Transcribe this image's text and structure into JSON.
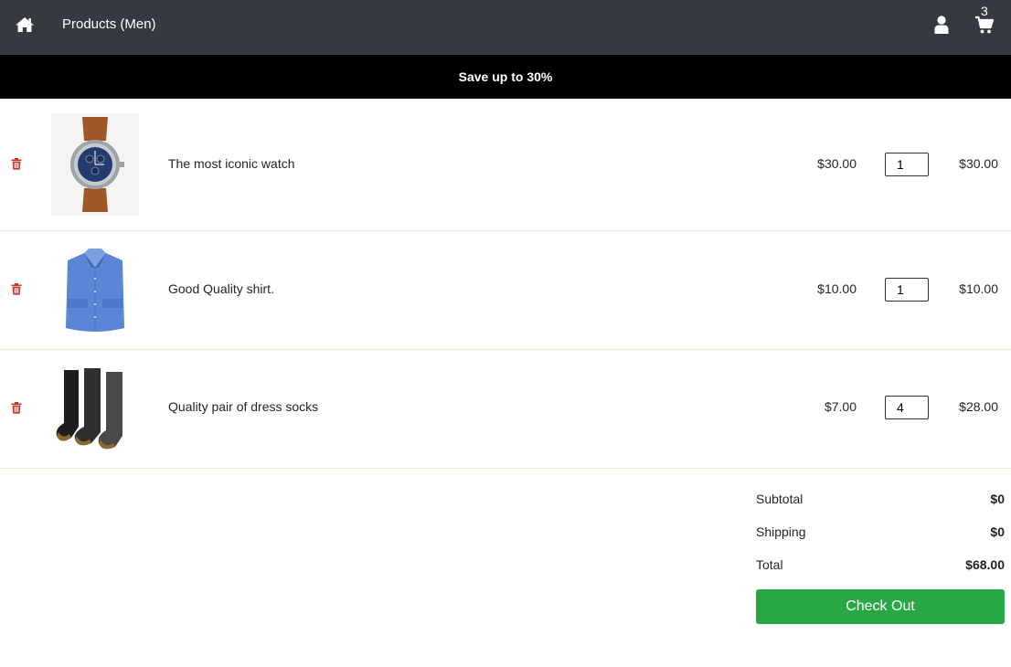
{
  "nav": {
    "title": "Products (Men)",
    "cart_count": "3"
  },
  "promo": {
    "text": "Save up to 30%"
  },
  "cart": {
    "items": [
      {
        "name": "The most iconic watch",
        "price": "$30.00",
        "quantity": "1",
        "total": "$30.00",
        "image": "wristwatch"
      },
      {
        "name": "Good Quality shirt.",
        "price": "$10.00",
        "quantity": "1",
        "total": "$10.00",
        "image": "blue-dress-shirt"
      },
      {
        "name": "Quality pair of dress socks",
        "price": "$7.00",
        "quantity": "4",
        "total": "$28.00",
        "image": "dress-socks"
      }
    ]
  },
  "summary": {
    "subtotal_label": "Subtotal",
    "subtotal_value": "$0",
    "shipping_label": "Shipping",
    "shipping_value": "$0",
    "total_label": "Total",
    "total_value": "$68.00",
    "checkout_label": "Check Out"
  },
  "colors": {
    "navbar": "#343a40",
    "promo_bar": "#000000",
    "trash_icon": "#c0392b",
    "checkout": "#28a745",
    "row_divider": "#f6eadb"
  },
  "icons": {
    "home": "home-icon",
    "user": "user-icon",
    "cart": "cart-icon",
    "remove": "trash-icon"
  }
}
